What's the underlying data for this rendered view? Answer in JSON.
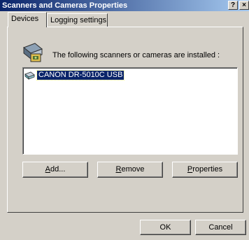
{
  "window": {
    "title": "Scanners and Cameras Properties",
    "help_label": "?",
    "close_label": "×"
  },
  "tabs": [
    {
      "label": "Devices",
      "active": true
    },
    {
      "label": "Logging settings",
      "active": false
    }
  ],
  "devices": {
    "description": "The following scanners or cameras are installed :",
    "list": [
      {
        "label": "CANON DR-5010C USB",
        "selected": true
      }
    ],
    "buttons": {
      "add": {
        "mnemonic": "A",
        "rest": "dd..."
      },
      "remove": {
        "mnemonic": "R",
        "rest": "emove"
      },
      "properties": {
        "mnemonic": "P",
        "rest": "roperties"
      }
    }
  },
  "footer": {
    "ok_label": "OK",
    "cancel_label": "Cancel"
  }
}
